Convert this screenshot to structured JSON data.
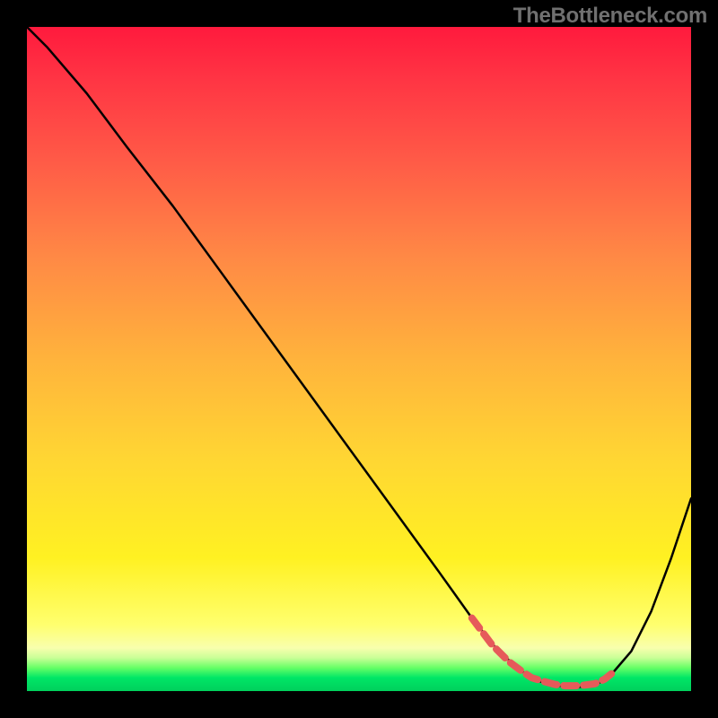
{
  "watermark": "TheBottleneck.com",
  "chart_data": {
    "type": "line",
    "title": "",
    "xlabel": "",
    "ylabel": "",
    "xlim": [
      0,
      100
    ],
    "ylim": [
      0,
      100
    ],
    "series": [
      {
        "name": "black-curve",
        "x": [
          0,
          3,
          9,
          15,
          22,
          30,
          38,
          46,
          54,
          62,
          67,
          71,
          74.5,
          77,
          80,
          83,
          85.5,
          88,
          91,
          94,
          97,
          100
        ],
        "values": [
          100,
          97,
          90,
          82,
          73,
          62,
          51,
          40,
          29,
          18,
          11,
          6,
          3,
          1.5,
          0.8,
          0.6,
          0.8,
          2.5,
          6,
          12,
          20,
          29
        ],
        "color": "#000000"
      },
      {
        "name": "red-segment",
        "x": [
          67,
          70,
          72.5,
          74.5,
          76,
          78,
          79.5,
          81,
          82.5,
          84,
          85.5,
          87,
          88
        ],
        "values": [
          11,
          7,
          4.5,
          3,
          2,
          1.4,
          1,
          0.8,
          0.8,
          0.9,
          1.1,
          1.8,
          2.6
        ],
        "color": "#e65a5a"
      }
    ],
    "background_gradient_stops": [
      {
        "pos": 0,
        "color": "#ff1a3d"
      },
      {
        "pos": 0.5,
        "color": "#ffd633"
      },
      {
        "pos": 0.95,
        "color": "#caff97"
      },
      {
        "pos": 1.0,
        "color": "#00d05c"
      }
    ]
  }
}
